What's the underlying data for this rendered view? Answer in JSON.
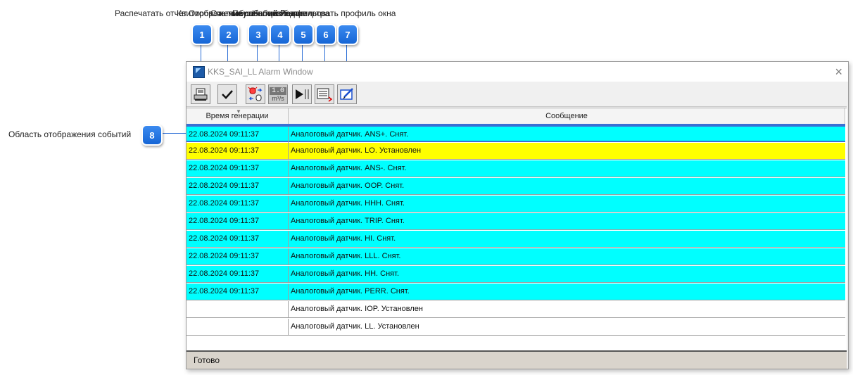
{
  "window": {
    "title": "KKS_SAI_LL Alarm Window",
    "close_symbol": "×",
    "status": "Готово"
  },
  "callouts": {
    "texts": [
      "Распечатать отчет",
      "Квитировать выбранное событие",
      "Отображение событий",
      "Счетчик событий",
      "Пауза обновления",
      "Настройка фильтра",
      "Редактировать профиль окна"
    ],
    "badges": [
      "1",
      "2",
      "3",
      "4",
      "5",
      "6",
      "7",
      "8"
    ],
    "events_area_label": "Область отображения событий"
  },
  "toolbar": {
    "buttons": [
      {
        "icon": "printer-icon"
      },
      {
        "icon": "checkmark-icon"
      },
      {
        "icon": "alarm-lamp-icon"
      },
      {
        "icon": "rate-counter-icon",
        "value": "1.0",
        "unit": "m³/s"
      },
      {
        "icon": "play-pause-icon"
      },
      {
        "icon": "filter-list-icon"
      },
      {
        "icon": "edit-profile-icon"
      }
    ]
  },
  "table": {
    "columns": [
      "Время генерации",
      "Сообщение"
    ],
    "rows": [
      {
        "time": "22.08.2024 09:11:37",
        "message": "Аналоговый датчик. ANS+. Снят.",
        "color": "#00ffff",
        "selected": true
      },
      {
        "time": "22.08.2024 09:11:37",
        "message": "Аналоговый датчик. LO. Установлен",
        "color": "#ffff00"
      },
      {
        "time": "22.08.2024 09:11:37",
        "message": "Аналоговый датчик. ANS-. Снят.",
        "color": "#00ffff"
      },
      {
        "time": "22.08.2024 09:11:37",
        "message": "Аналоговый датчик. OOP. Снят.",
        "color": "#00ffff"
      },
      {
        "time": "22.08.2024 09:11:37",
        "message": "Аналоговый датчик. HHH. Снят.",
        "color": "#00ffff"
      },
      {
        "time": "22.08.2024 09:11:37",
        "message": "Аналоговый датчик. TRIP. Снят.",
        "color": "#00ffff"
      },
      {
        "time": "22.08.2024 09:11:37",
        "message": "Аналоговый датчик. HI. Снят.",
        "color": "#00ffff"
      },
      {
        "time": "22.08.2024 09:11:37",
        "message": "Аналоговый датчик. LLL. Снят.",
        "color": "#00ffff"
      },
      {
        "time": "22.08.2024 09:11:37",
        "message": "Аналоговый датчик. HH. Снят.",
        "color": "#00ffff"
      },
      {
        "time": "22.08.2024 09:11:37",
        "message": "Аналоговый датчик. PERR. Снят.",
        "color": "#00ffff"
      },
      {
        "time": "",
        "message": "Аналоговый датчик. IOP. Установлен",
        "color": "#ffffff"
      },
      {
        "time": "",
        "message": "Аналоговый датчик. LL. Установлен",
        "color": "#ffffff"
      }
    ]
  }
}
